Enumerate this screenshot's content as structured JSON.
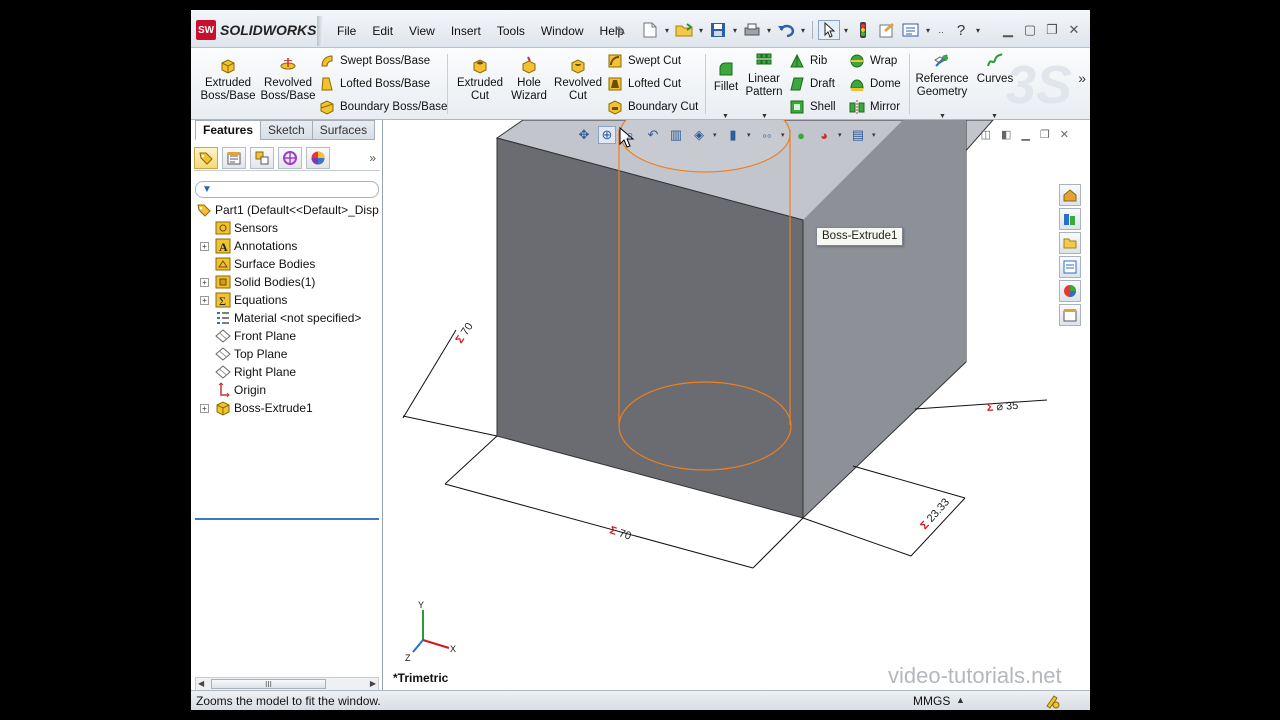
{
  "app": {
    "logo_text": "SOLIDWORKS",
    "menus": [
      "File",
      "Edit",
      "View",
      "Insert",
      "Tools",
      "Window",
      "Help"
    ]
  },
  "ribbon": {
    "extruded_boss": "Extruded Boss/Base",
    "revolved_boss": "Revolved Boss/Base",
    "swept_boss": "Swept Boss/Base",
    "lofted_boss": "Lofted Boss/Base",
    "boundary_boss": "Boundary Boss/Base",
    "extruded_cut": "Extruded Cut",
    "hole_wizard": "Hole Wizard",
    "revolved_cut": "Revolved Cut",
    "swept_cut": "Swept Cut",
    "lofted_cut": "Lofted Cut",
    "boundary_cut": "Boundary Cut",
    "fillet": "Fillet",
    "linear_pattern": "Linear Pattern",
    "rib": "Rib",
    "draft": "Draft",
    "shell": "Shell",
    "wrap": "Wrap",
    "dome": "Dome",
    "mirror": "Mirror",
    "reference_geometry": "Reference Geometry",
    "curves": "Curves"
  },
  "tabs": [
    "Features",
    "Sketch",
    "Surfaces"
  ],
  "tree": {
    "root": "Part1  (Default<<Default>_Disp",
    "items": [
      {
        "label": "Sensors",
        "expandable": false
      },
      {
        "label": "Annotations",
        "expandable": true
      },
      {
        "label": "Surface Bodies",
        "expandable": false
      },
      {
        "label": "Solid Bodies(1)",
        "expandable": true
      },
      {
        "label": "Equations",
        "expandable": true
      },
      {
        "label": "Material <not specified>",
        "expandable": false
      },
      {
        "label": "Front Plane",
        "expandable": false
      },
      {
        "label": "Top Plane",
        "expandable": false
      },
      {
        "label": "Right Plane",
        "expandable": false
      },
      {
        "label": "Origin",
        "expandable": false
      },
      {
        "label": "Boss-Extrude1",
        "expandable": true
      }
    ]
  },
  "viewport": {
    "tooltip": "Boss-Extrude1",
    "view_name": "*Trimetric",
    "dims": {
      "width": "70",
      "depth": "70",
      "diameter": "⌀ 35",
      "offset": "23.33"
    },
    "axes": {
      "x": "X",
      "y": "Y",
      "z": "Z"
    },
    "watermark": "video-tutorials.net"
  },
  "status": {
    "message": "Zooms the model to fit the window.",
    "units": "MMGS"
  },
  "colors": {
    "accent": "#3a78c8",
    "selection_outline": "#f07f1c",
    "dimension_marker": "#d21919",
    "part_front": "#6a6c72",
    "part_right": "#8d9097",
    "part_top": "#c2c5cc"
  }
}
